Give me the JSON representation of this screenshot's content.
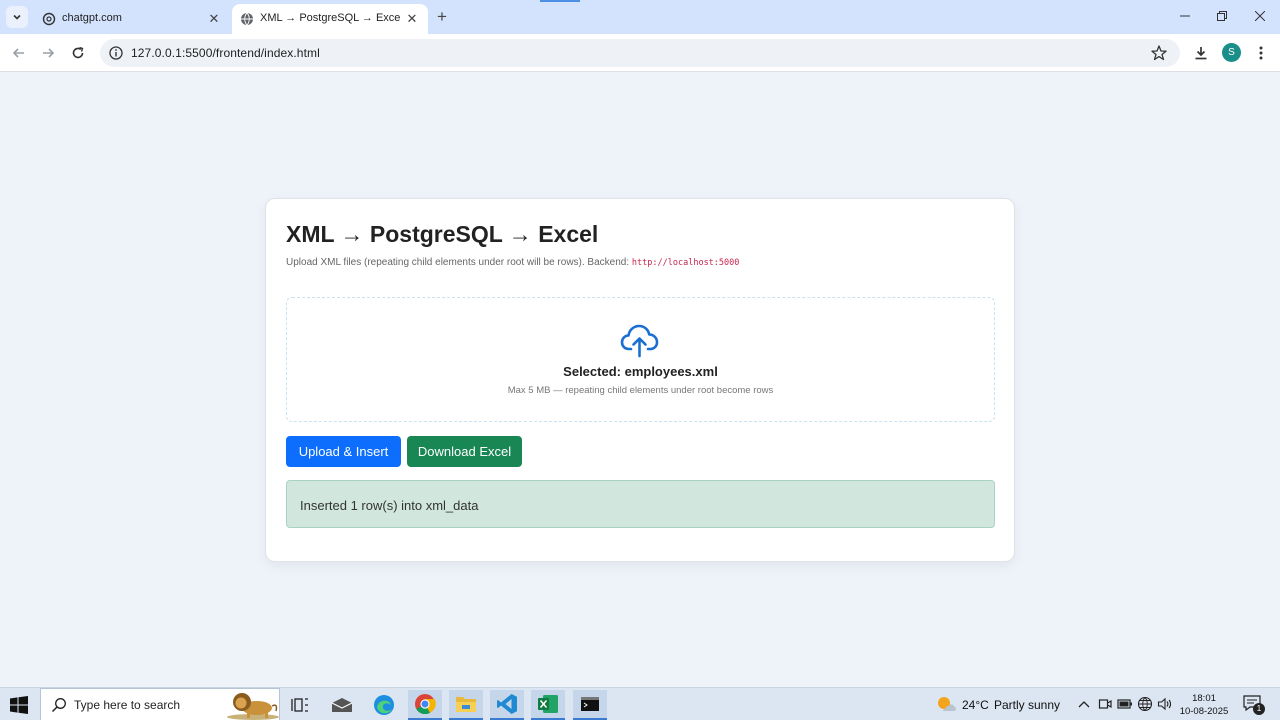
{
  "browser": {
    "tabs": [
      {
        "title": "chatgpt.com",
        "active": false
      },
      {
        "title": "XML → PostgreSQL → Excel",
        "active": true
      }
    ],
    "url": "127.0.0.1:5500/frontend/index.html",
    "profile_initial": "S"
  },
  "page": {
    "title": "XML → PostgreSQL → Excel",
    "subtitle": "Upload XML files (repeating child elements under root will be rows). Backend:",
    "backend_url": "http://localhost:5000",
    "dropzone": {
      "selected_text": "Selected: employees.xml",
      "hint": "Max 5 MB — repeating child elements under root become rows"
    },
    "buttons": {
      "upload": "Upload & Insert",
      "download": "Download Excel"
    },
    "status_message": "Inserted 1 row(s) into xml_data",
    "colors": {
      "primary": "#0d6efd",
      "success": "#198754",
      "alert_bg": "#d1e7dd",
      "accent_icon": "#1a6fd1"
    }
  },
  "taskbar": {
    "search_placeholder": "Type here to search",
    "apps": [
      "task-view-icon",
      "mail-icon",
      "edge-icon",
      "chrome-icon",
      "file-explorer-icon",
      "vscode-icon",
      "excel-icon",
      "terminal-icon"
    ],
    "weather_temp": "24°C",
    "weather_desc": "Partly sunny",
    "time": "18:01",
    "date": "10-08-2025",
    "notification_count": "1"
  }
}
